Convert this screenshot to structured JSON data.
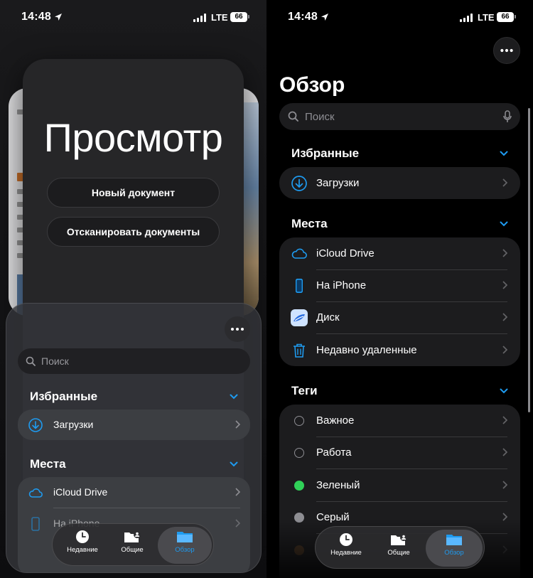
{
  "status_bar": {
    "time": "14:48",
    "network": "LTE",
    "battery": "66"
  },
  "left_screen": {
    "preview_window": {
      "title": "Просмотр",
      "new_document": "Новый документ",
      "scan_documents": "Отсканировать документы"
    },
    "files_window": {
      "search_placeholder": "Поиск",
      "favorites_title": "Избранные",
      "favorites": [
        {
          "label": "Загрузки",
          "icon": "download-circle-icon"
        }
      ],
      "locations_title": "Места",
      "locations": [
        {
          "label": "iCloud Drive",
          "icon": "icloud-icon"
        },
        {
          "label": "На iPhone",
          "icon": "iphone-icon"
        }
      ]
    },
    "tabs": [
      {
        "label": "Недавние",
        "icon": "clock-icon"
      },
      {
        "label": "Общие",
        "icon": "shared-folder-icon"
      },
      {
        "label": "Обзор",
        "icon": "folder-icon",
        "active": true
      }
    ]
  },
  "right_screen": {
    "title": "Обзор",
    "search_placeholder": "Поиск",
    "favorites_title": "Избранные",
    "favorites": [
      {
        "label": "Загрузки",
        "icon": "download-circle-icon"
      }
    ],
    "locations_title": "Места",
    "locations": [
      {
        "label": "iCloud Drive",
        "icon": "icloud-icon"
      },
      {
        "label": "На iPhone",
        "icon": "iphone-icon"
      },
      {
        "label": "Диск",
        "icon": "disk-app-icon"
      },
      {
        "label": "Недавно удаленные",
        "icon": "trash-icon"
      }
    ],
    "tags_title": "Теги",
    "tags": [
      {
        "label": "Важное",
        "color": ""
      },
      {
        "label": "Работа",
        "color": ""
      },
      {
        "label": "Зеленый",
        "color": "#30d158"
      },
      {
        "label": "Серый",
        "color": "#8e8e93"
      }
    ],
    "tabs": [
      {
        "label": "Недавние",
        "icon": "clock-icon"
      },
      {
        "label": "Общие",
        "icon": "shared-folder-icon"
      },
      {
        "label": "Обзор",
        "icon": "folder-icon",
        "active": true
      }
    ]
  },
  "colors": {
    "accent": "#1e9bf0"
  }
}
